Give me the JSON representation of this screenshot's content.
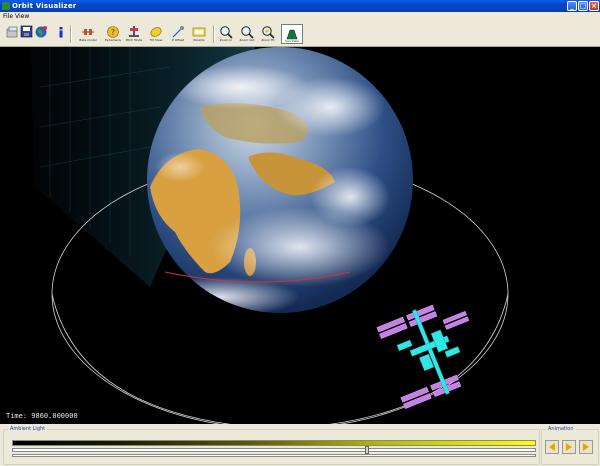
{
  "window": {
    "title": "Orbit Visualizer"
  },
  "menu": {
    "file": "File",
    "view": "View"
  },
  "toolbar": {
    "labels": [
      "Beta model",
      "Ephemeris",
      "Pitch Mode",
      "Tilt View",
      "P Offset",
      "Params",
      "Zoom In",
      "Zoom Out",
      "Zoom Fit",
      "Sun View"
    ]
  },
  "viewport": {
    "time": "Time: 9860.000000"
  },
  "bottom": {
    "ambient_legend": "Ambient Light",
    "animation_legend": "Animation"
  },
  "ambient_level": 0.68,
  "colors": {
    "space": "#000000",
    "orbit": "#dcdcdc",
    "panel": "#ece9d8",
    "station_truss": "#33e6e6",
    "station_panels": "#c87ee8"
  },
  "icons": [
    "app-icon",
    "minimize-icon",
    "maximize-icon",
    "close-icon",
    "zoom-in-icon",
    "zoom-out-icon",
    "zoom-fit-icon",
    "prev-icon",
    "play-icon",
    "next-icon"
  ]
}
